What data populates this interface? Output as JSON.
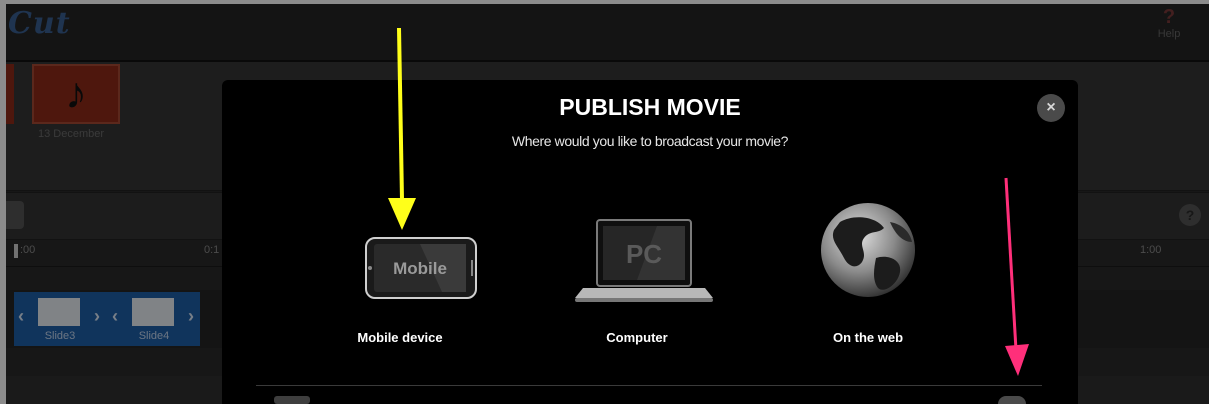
{
  "app": {
    "logo_text": "Cut"
  },
  "header": {
    "help_label": "Help",
    "help_icon": "help-icon"
  },
  "media": {
    "item_label": "13 December",
    "item_icon": "music-note-icon"
  },
  "toolbar": {
    "help_glyph": "?"
  },
  "timeline": {
    "ticks": [
      ":00",
      "0:1",
      "1:00"
    ],
    "slides": [
      {
        "label": "Slide3"
      },
      {
        "label": "Slide4"
      }
    ]
  },
  "modal": {
    "title": "PUBLISH MOVIE",
    "subtitle": "Where would you like to broadcast your movie?",
    "close_glyph": "×",
    "options": [
      {
        "label": "Mobile device",
        "icon": "mobile-phone-icon",
        "icon_text": "Mobile"
      },
      {
        "label": "Computer",
        "icon": "laptop-icon",
        "icon_text": "PC"
      },
      {
        "label": "On the web",
        "icon": "globe-icon"
      }
    ]
  },
  "annotations": {
    "arrow_colors": {
      "yellow": "#ffff1a",
      "pink": "#ff2f7a"
    }
  }
}
